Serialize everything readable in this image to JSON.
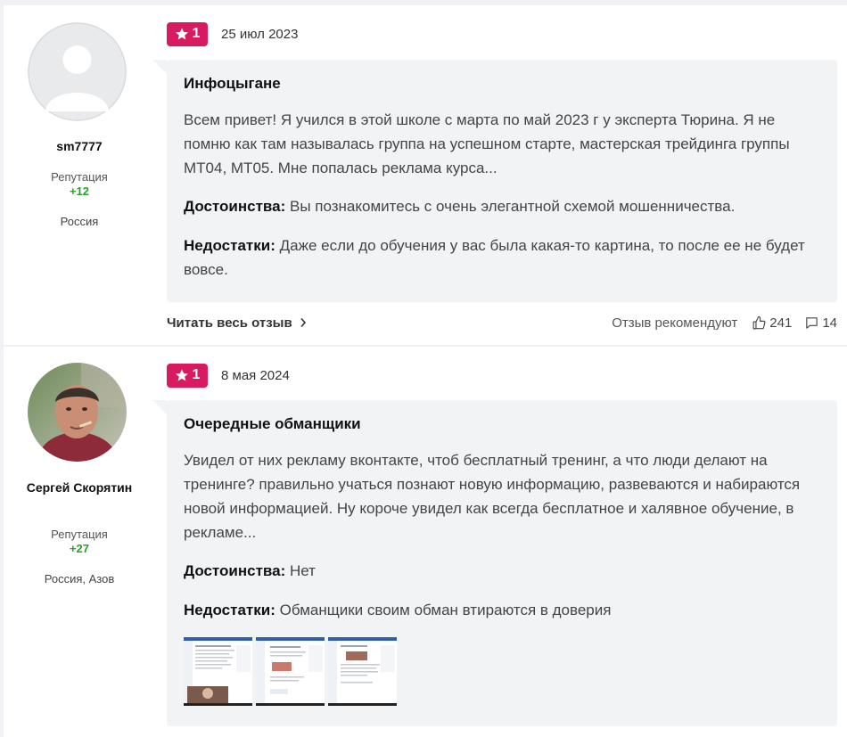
{
  "reviews": [
    {
      "author": {
        "name": "sm7777",
        "reputation_label": "Репутация",
        "reputation_value": "+12",
        "location": "Россия"
      },
      "rating": "1",
      "date": "25 июл 2023",
      "title": "Инфоцыгане",
      "text": "Всем привет! Я учился в этой школе с марта по май 2023 г у эксперта Тюрина. Я не помню как там называлась группа на успешном старте, мастерская трейдинга группы МТ04, МТ05. Мне попалась реклама курса...",
      "pros_label": "Достоинства:",
      "pros": "Вы познакомитесь с очень элегантной схемой мошенничества.",
      "cons_label": "Недостатки:",
      "cons": "Даже если до обучения у вас была какая-то картина, то после ее не будет вовсе.",
      "read_more": "Читать весь отзыв",
      "recommend_label": "Отзыв рекомендуют",
      "likes": "241",
      "comments": "14"
    },
    {
      "author": {
        "name": "Сергей Скорятин",
        "reputation_label": "Репутация",
        "reputation_value": "+27",
        "location": "Россия, Азов"
      },
      "rating": "1",
      "date": "8 мая 2024",
      "title": "Очередные обманщики",
      "text": "Увидел от них рекламу вконтакте, чтоб бесплатный тренинг, а что люди делают на тренинге? правильно учаться познают новую информацию, развеваются и набираются новой информацией. Ну короче увидел как всегда бесплатное и халявное обучение, в рекламе...",
      "pros_label": "Достоинства:",
      "pros": "Нет",
      "cons_label": "Недостатки:",
      "cons": "Обманщики своим обман втираются в доверия"
    }
  ],
  "colors": {
    "rating_badge": "#d81b60",
    "reputation": "#2ca02c",
    "card_body": "#f2f3f5",
    "page_background": "#f0f1f4"
  },
  "icons": [
    "star-icon",
    "chevron-right-icon",
    "thumbs-up-icon",
    "comment-icon",
    "avatar-placeholder-icon"
  ]
}
